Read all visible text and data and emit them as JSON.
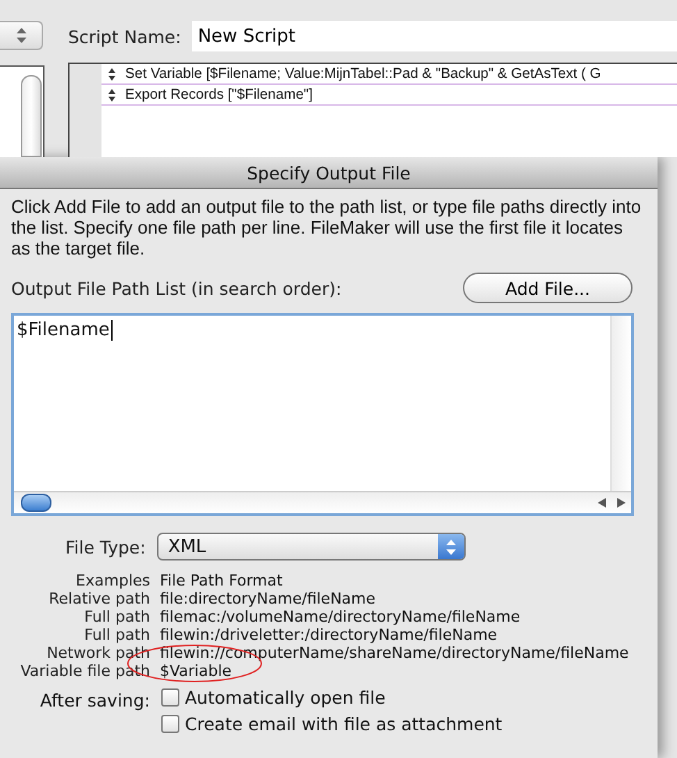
{
  "script_editor": {
    "script_name_label": "Script Name:",
    "script_name_value": "New Script",
    "steps": [
      "Set Variable [$Filename; Value:MijnTabel::Pad & \"Backup\" & GetAsText ( G",
      "Export Records [\"$Filename\"]"
    ]
  },
  "dialog": {
    "title": "Specify Output File",
    "description": "Click Add File to add an output file to the path list, or type file paths directly into the list. Specify one file path per line. FileMaker will use the first file it locates as the target file.",
    "path_list_label": "Output File Path List (in search order):",
    "add_button": "Add File...",
    "path_list_value": "$Filename",
    "file_type_label": "File Type:",
    "file_type_value": "XML",
    "examples_header": {
      "label": "Examples",
      "value": "File Path Format"
    },
    "examples": [
      {
        "label": "Relative path",
        "value": "file:directoryName/fileName"
      },
      {
        "label": "Full path",
        "value": "filemac:/volumeName/directoryName/fileName"
      },
      {
        "label": "Full path",
        "value": "filewin:/driveletter:/directoryName/fileName"
      },
      {
        "label": "Network path",
        "value": "filewin://computerName/shareName/directoryName/fileName"
      },
      {
        "label": "Variable file path",
        "value": "$Variable"
      }
    ],
    "after_saving_label": "After saving:",
    "options": [
      {
        "label": "Automatically open file",
        "checked": false
      },
      {
        "label": "Create email with file as attachment",
        "checked": false
      }
    ]
  }
}
